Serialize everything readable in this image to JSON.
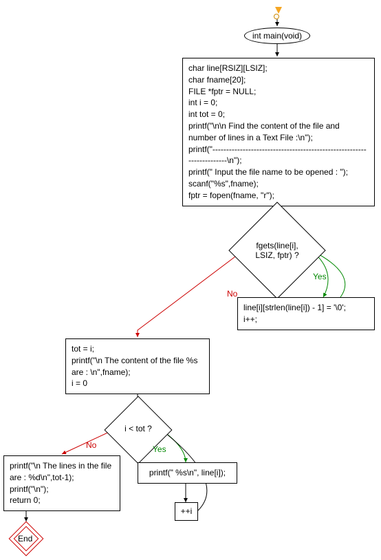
{
  "chart_data": {
    "type": "flowchart",
    "title": "",
    "nodes": [
      {
        "id": "start",
        "type": "start",
        "label": ""
      },
      {
        "id": "main",
        "type": "ellipse",
        "label": "int main(void)"
      },
      {
        "id": "block1",
        "type": "process",
        "label": "char line[RSIZ][LSIZ];\nchar fname[20];\nFILE *fptr = NULL;\nint i = 0;\nint tot = 0;\nprintf(\"\\n\\n Find the content of the file and number of lines in a Text File :\\n\");\nprintf(\"----------------------------------------------------------------------\\n\");\nprintf(\" Input the file name to be opened : \");\nscanf(\"%s\",fname);\nfptr = fopen(fname, \"r\");"
      },
      {
        "id": "cond1",
        "type": "decision",
        "label": "fgets(line[i], LSIZ, fptr) ?"
      },
      {
        "id": "yes1",
        "type": "process",
        "label": "line[i][strlen(line[i]) - 1] = '\\0';\ni++;"
      },
      {
        "id": "no1",
        "type": "process",
        "label": "tot = i;\nprintf(\"\\n The content of the file %s  are : \\n\",fname);\ni = 0"
      },
      {
        "id": "cond2",
        "type": "decision",
        "label": "i < tot ?"
      },
      {
        "id": "yes2",
        "type": "process",
        "label": "printf(\" %s\\n\", line[i]);"
      },
      {
        "id": "inc",
        "type": "process",
        "label": "++i"
      },
      {
        "id": "no2",
        "type": "process",
        "label": "printf(\"\\n The lines in the file are : %d\\n\",tot-1);\nprintf(\"\\n\");\nreturn 0;"
      },
      {
        "id": "end",
        "type": "end",
        "label": "End"
      }
    ],
    "edges": [
      {
        "from": "start",
        "to": "main",
        "label": ""
      },
      {
        "from": "main",
        "to": "block1",
        "label": ""
      },
      {
        "from": "block1",
        "to": "cond1",
        "label": ""
      },
      {
        "from": "cond1",
        "to": "yes1",
        "label": "Yes"
      },
      {
        "from": "yes1",
        "to": "cond1",
        "label": ""
      },
      {
        "from": "cond1",
        "to": "no1",
        "label": "No"
      },
      {
        "from": "no1",
        "to": "cond2",
        "label": ""
      },
      {
        "from": "cond2",
        "to": "yes2",
        "label": "Yes"
      },
      {
        "from": "yes2",
        "to": "inc",
        "label": ""
      },
      {
        "from": "inc",
        "to": "cond2",
        "label": ""
      },
      {
        "from": "cond2",
        "to": "no2",
        "label": "No"
      },
      {
        "from": "no2",
        "to": "end",
        "label": ""
      }
    ]
  },
  "labels": {
    "main": "int main(void)",
    "block1_l1": "char line[RSIZ][LSIZ];",
    "block1_l2": "char fname[20];",
    "block1_l3": "FILE *fptr = NULL;",
    "block1_l4": "int i = 0;",
    "block1_l5": "int tot = 0;",
    "block1_l6": "printf(\"\\n\\n Find the content of the file and number of lines in a Text File :\\n\");",
    "block1_l7": "printf(\"----------------------------------------------------------------------\\n\");",
    "block1_l8": "printf(\" Input the file name to be opened : \");",
    "block1_l9": "scanf(\"%s\",fname);",
    "block1_l10": "fptr = fopen(fname, \"r\");",
    "cond1_a": "fgets(line[i],",
    "cond1_b": "LSIZ, fptr) ?",
    "yes1_l1": "line[i][strlen(line[i]) - 1] = '\\0';",
    "yes1_l2": "i++;",
    "no1_l1": "tot = i;",
    "no1_l2": "printf(\"\\n The content of the file %s  are : \\n\",fname);",
    "no1_l3": "i = 0",
    "cond2": "i < tot ?",
    "yes2": "printf(\" %s\\n\", line[i]);",
    "inc": "++i",
    "no2_l1": "printf(\"\\n The lines in the file are : %d\\n\",tot-1);",
    "no2_l2": "printf(\"\\n\");",
    "no2_l3": "return 0;",
    "end": "End",
    "yes": "Yes",
    "no": "No"
  }
}
